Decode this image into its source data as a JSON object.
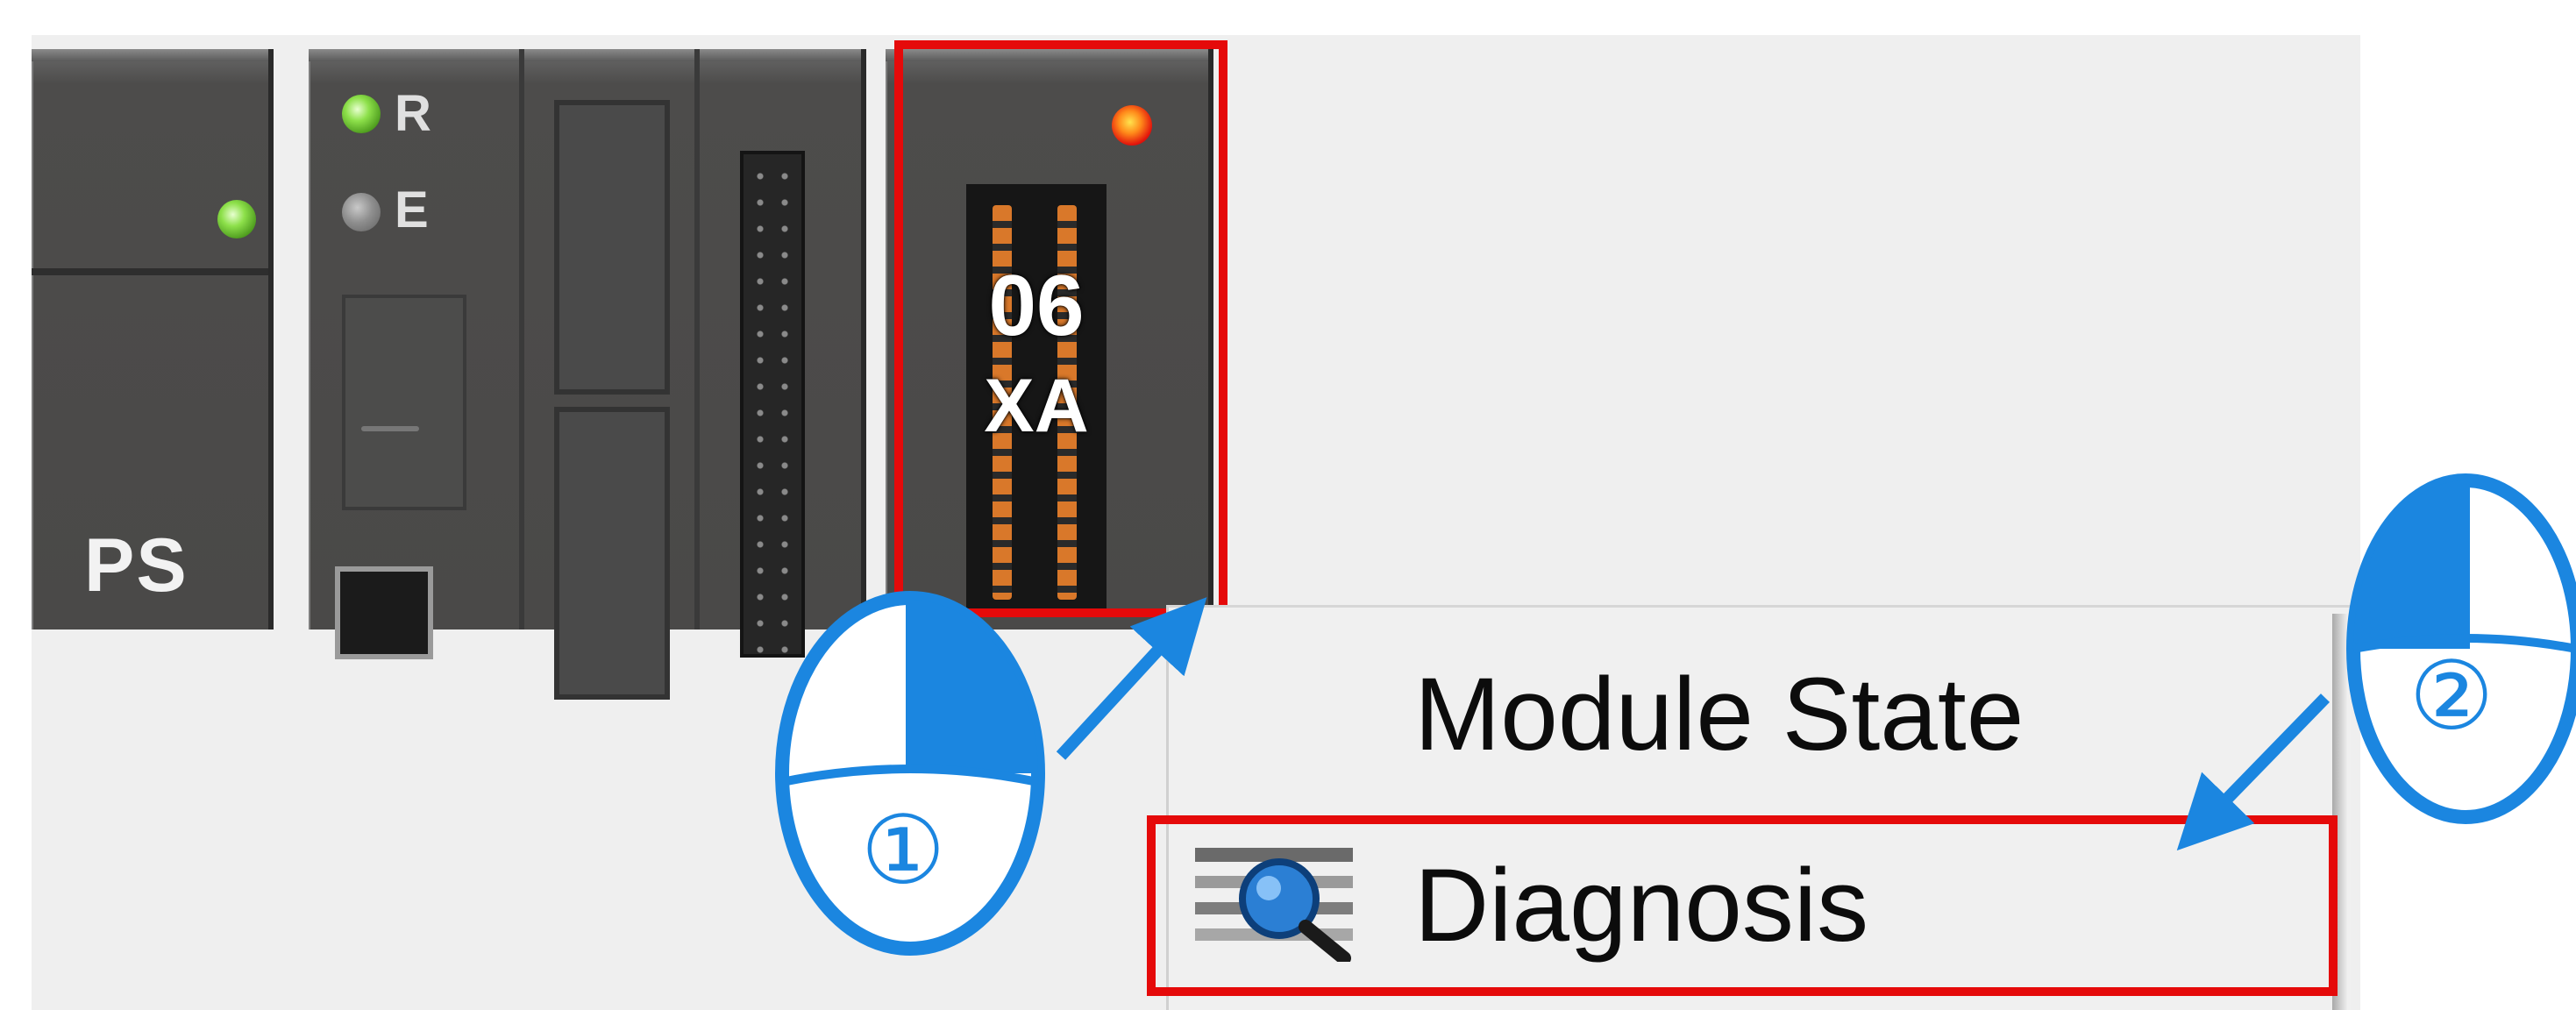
{
  "rack": {
    "power_module": {
      "label": "PS",
      "led": "green"
    },
    "cpu_module": {
      "led_run_label": "R",
      "led_run_state": "green",
      "led_error_label": "E",
      "led_error_state": "gray"
    },
    "io_module": {
      "code_line_1": "06",
      "code_line_2": "XA",
      "led": "red",
      "selected": true
    }
  },
  "context_menu": {
    "items": [
      {
        "label": "Module State",
        "icon": "none"
      },
      {
        "label": "Diagnosis",
        "icon": "diagnosis-magnifier-icon",
        "highlighted": true
      }
    ]
  },
  "callouts": {
    "step_1": "①",
    "step_2": "②"
  },
  "colors": {
    "highlight": "#e50a0a",
    "callout_blue": "#1b86e0",
    "canvas": "#efefef",
    "module_body": "#4a4948"
  }
}
